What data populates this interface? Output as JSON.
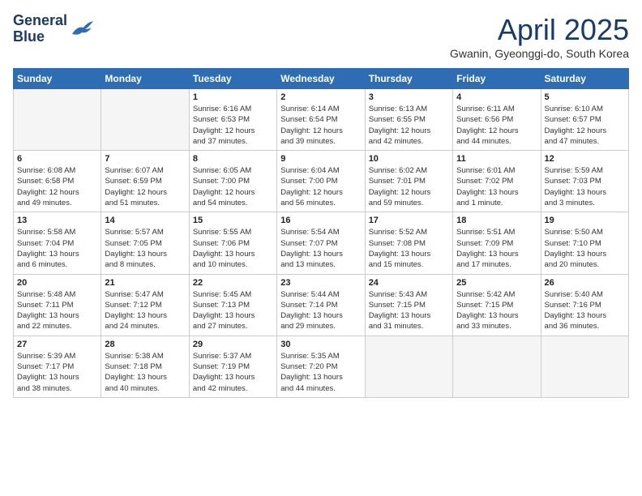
{
  "header": {
    "logo_line1": "General",
    "logo_line2": "Blue",
    "month": "April 2025",
    "location": "Gwanin, Gyeonggi-do, South Korea"
  },
  "weekdays": [
    "Sunday",
    "Monday",
    "Tuesday",
    "Wednesday",
    "Thursday",
    "Friday",
    "Saturday"
  ],
  "weeks": [
    [
      {
        "day": "",
        "detail": ""
      },
      {
        "day": "",
        "detail": ""
      },
      {
        "day": "1",
        "detail": "Sunrise: 6:16 AM\nSunset: 6:53 PM\nDaylight: 12 hours\nand 37 minutes."
      },
      {
        "day": "2",
        "detail": "Sunrise: 6:14 AM\nSunset: 6:54 PM\nDaylight: 12 hours\nand 39 minutes."
      },
      {
        "day": "3",
        "detail": "Sunrise: 6:13 AM\nSunset: 6:55 PM\nDaylight: 12 hours\nand 42 minutes."
      },
      {
        "day": "4",
        "detail": "Sunrise: 6:11 AM\nSunset: 6:56 PM\nDaylight: 12 hours\nand 44 minutes."
      },
      {
        "day": "5",
        "detail": "Sunrise: 6:10 AM\nSunset: 6:57 PM\nDaylight: 12 hours\nand 47 minutes."
      }
    ],
    [
      {
        "day": "6",
        "detail": "Sunrise: 6:08 AM\nSunset: 6:58 PM\nDaylight: 12 hours\nand 49 minutes."
      },
      {
        "day": "7",
        "detail": "Sunrise: 6:07 AM\nSunset: 6:59 PM\nDaylight: 12 hours\nand 51 minutes."
      },
      {
        "day": "8",
        "detail": "Sunrise: 6:05 AM\nSunset: 7:00 PM\nDaylight: 12 hours\nand 54 minutes."
      },
      {
        "day": "9",
        "detail": "Sunrise: 6:04 AM\nSunset: 7:00 PM\nDaylight: 12 hours\nand 56 minutes."
      },
      {
        "day": "10",
        "detail": "Sunrise: 6:02 AM\nSunset: 7:01 PM\nDaylight: 12 hours\nand 59 minutes."
      },
      {
        "day": "11",
        "detail": "Sunrise: 6:01 AM\nSunset: 7:02 PM\nDaylight: 13 hours\nand 1 minute."
      },
      {
        "day": "12",
        "detail": "Sunrise: 5:59 AM\nSunset: 7:03 PM\nDaylight: 13 hours\nand 3 minutes."
      }
    ],
    [
      {
        "day": "13",
        "detail": "Sunrise: 5:58 AM\nSunset: 7:04 PM\nDaylight: 13 hours\nand 6 minutes."
      },
      {
        "day": "14",
        "detail": "Sunrise: 5:57 AM\nSunset: 7:05 PM\nDaylight: 13 hours\nand 8 minutes."
      },
      {
        "day": "15",
        "detail": "Sunrise: 5:55 AM\nSunset: 7:06 PM\nDaylight: 13 hours\nand 10 minutes."
      },
      {
        "day": "16",
        "detail": "Sunrise: 5:54 AM\nSunset: 7:07 PM\nDaylight: 13 hours\nand 13 minutes."
      },
      {
        "day": "17",
        "detail": "Sunrise: 5:52 AM\nSunset: 7:08 PM\nDaylight: 13 hours\nand 15 minutes."
      },
      {
        "day": "18",
        "detail": "Sunrise: 5:51 AM\nSunset: 7:09 PM\nDaylight: 13 hours\nand 17 minutes."
      },
      {
        "day": "19",
        "detail": "Sunrise: 5:50 AM\nSunset: 7:10 PM\nDaylight: 13 hours\nand 20 minutes."
      }
    ],
    [
      {
        "day": "20",
        "detail": "Sunrise: 5:48 AM\nSunset: 7:11 PM\nDaylight: 13 hours\nand 22 minutes."
      },
      {
        "day": "21",
        "detail": "Sunrise: 5:47 AM\nSunset: 7:12 PM\nDaylight: 13 hours\nand 24 minutes."
      },
      {
        "day": "22",
        "detail": "Sunrise: 5:45 AM\nSunset: 7:13 PM\nDaylight: 13 hours\nand 27 minutes."
      },
      {
        "day": "23",
        "detail": "Sunrise: 5:44 AM\nSunset: 7:14 PM\nDaylight: 13 hours\nand 29 minutes."
      },
      {
        "day": "24",
        "detail": "Sunrise: 5:43 AM\nSunset: 7:15 PM\nDaylight: 13 hours\nand 31 minutes."
      },
      {
        "day": "25",
        "detail": "Sunrise: 5:42 AM\nSunset: 7:15 PM\nDaylight: 13 hours\nand 33 minutes."
      },
      {
        "day": "26",
        "detail": "Sunrise: 5:40 AM\nSunset: 7:16 PM\nDaylight: 13 hours\nand 36 minutes."
      }
    ],
    [
      {
        "day": "27",
        "detail": "Sunrise: 5:39 AM\nSunset: 7:17 PM\nDaylight: 13 hours\nand 38 minutes."
      },
      {
        "day": "28",
        "detail": "Sunrise: 5:38 AM\nSunset: 7:18 PM\nDaylight: 13 hours\nand 40 minutes."
      },
      {
        "day": "29",
        "detail": "Sunrise: 5:37 AM\nSunset: 7:19 PM\nDaylight: 13 hours\nand 42 minutes."
      },
      {
        "day": "30",
        "detail": "Sunrise: 5:35 AM\nSunset: 7:20 PM\nDaylight: 13 hours\nand 44 minutes."
      },
      {
        "day": "",
        "detail": ""
      },
      {
        "day": "",
        "detail": ""
      },
      {
        "day": "",
        "detail": ""
      }
    ]
  ]
}
